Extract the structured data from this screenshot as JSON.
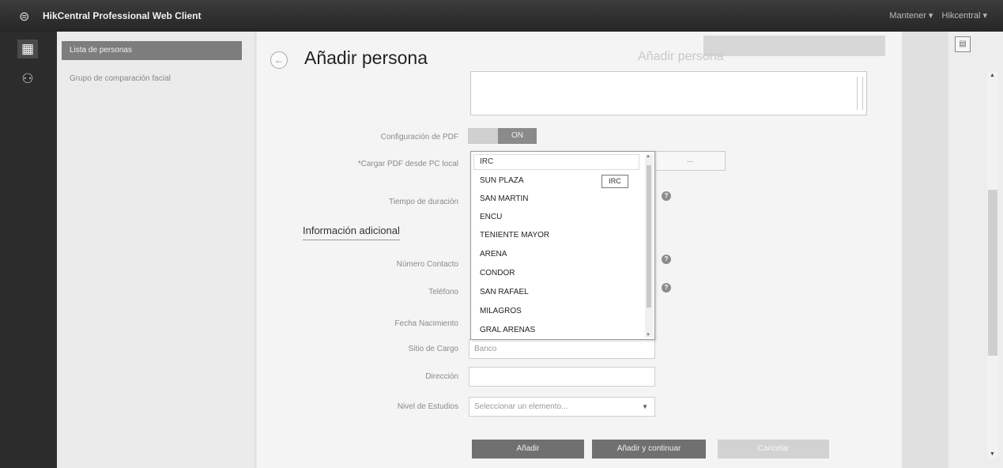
{
  "topbar": {
    "app_title": "HikCentral Professional Web Client",
    "right_items": [
      "Mantener ▾",
      "Hikcentral ▾"
    ]
  },
  "rail": {
    "icons": [
      "home-icon",
      "person-icon"
    ]
  },
  "nav": {
    "items": [
      {
        "label": "Lista de personas",
        "active": true
      },
      {
        "label": "Grupo de comparación facial",
        "active": false
      }
    ]
  },
  "page": {
    "title": "Añadir persona",
    "ghost_title": "Añadir persona"
  },
  "form": {
    "pdf_config_label": "Configuración de PDF",
    "pdf_toggle_on": "ON",
    "pdf_load_label": "*Cargar PDF desde PC local",
    "ellipsis_button": "...",
    "time_label": "Tiempo de duración",
    "additional_heading": "Información adicional",
    "contact_label": "Número Contacto",
    "phone_label": "Teléfono",
    "birthdate_label": "Fecha Nacimiento",
    "position_label": "Sitio de Cargo",
    "position_value": "Banco",
    "address_label": "Dirección",
    "address_value": "",
    "studies_label": "Nivel de Estudios",
    "studies_value": "Seleccionar un elemento..."
  },
  "dropdown": {
    "input_value": "IRC",
    "tooltip": "IRC",
    "items": [
      "SUN PLAZA",
      "SAN MARTIN",
      "ENCU",
      "TENIENTE MAYOR",
      "ARENA",
      "CONDOR",
      "SAN RAFAEL",
      "MILAGROS",
      "GRAL ARENAS"
    ]
  },
  "buttons": {
    "add": "Añadir",
    "add_continue": "Añadir y continuar",
    "cancel": "Cancelar"
  },
  "colors": {
    "topbar": "#2e2e2e",
    "primary_button": "#707070",
    "cancel_button": "#d2d2d2"
  }
}
